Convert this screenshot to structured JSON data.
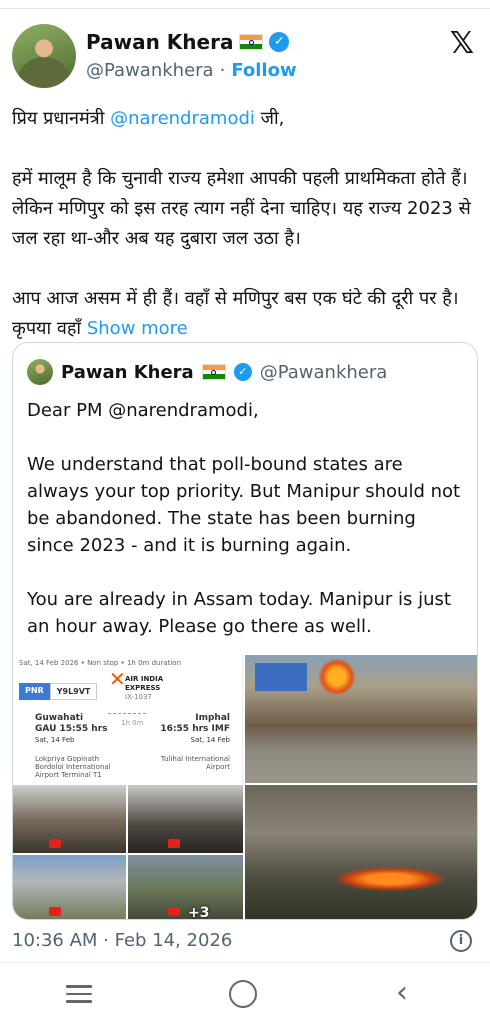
{
  "tweet": {
    "author_name": "Pawan Khera",
    "author_handle": "@Pawankhera",
    "follow_separator": "·",
    "follow_label": "Follow",
    "text": {
      "para1_prefix": "प्रिय प्रधानमंत्री ",
      "para1_mention": "@narendramodi",
      "para1_suffix": " जी,",
      "para2": "हमें मालूम है कि चुनावी राज्य हमेशा आपकी पहली प्राथमिकता होते हैं। लेकिन मणिपुर को इस तरह त्याग नहीं देना चाहिए। यह राज्य 2023 से जल रहा था-और अब यह दुबारा जल उठा है।",
      "para3": "आप आज असम में ही हैं। वहाँ से मणिपुर बस एक घंटे की दूरी पर है। कृपया वहाँ",
      "show_more": "Show more"
    },
    "timestamp": "10:36 AM · Feb 14, 2026"
  },
  "quoted": {
    "author_name": "Pawan Khera",
    "author_handle": "@Pawankhera",
    "para1": "Dear PM @narendramodi,",
    "para2": "We understand that poll-bound states are always your top priority. But Manipur should not be abandoned. The state has been burning since 2023 - and it is burning again.",
    "para3": "You are already in Assam today. Manipur is just an hour away. Please go there as well.",
    "media": {
      "ticket": {
        "date_line": "Sat, 14 Feb 2026 • Non stop • 1h 0m duration",
        "pnr_label": "PNR",
        "pnr_value": "Y9L9VT",
        "airline_line1": "AIR INDIA",
        "airline_line2": "EXPRESS",
        "flight_no": "IX-1037",
        "from_city": "Guwahati",
        "from_time": "GAU 15:55 hrs",
        "from_date": "Sat, 14 Feb",
        "duration": "1h 0m",
        "to_city": "Imphal",
        "to_time": "16:55 hrs IMF",
        "to_date": "Sat, 14 Feb",
        "from_terminal_1": "Lokpriya Gopinath",
        "from_terminal_2": "Bordoloi International",
        "from_terminal_3": "Airport Terminal T1",
        "to_terminal_1": "Tulihal International",
        "to_terminal_2": "Airport"
      },
      "more_count": "+3"
    }
  },
  "icons": {
    "x_logo": "𝕏",
    "verified": "✓",
    "info": "i",
    "back": "‹"
  }
}
